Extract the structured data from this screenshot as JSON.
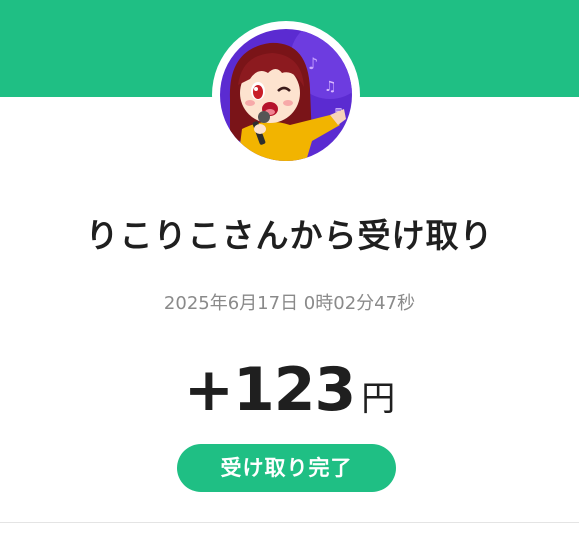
{
  "header": {
    "band_color": "#1fbf84"
  },
  "avatar": {
    "icon": "user-avatar-anime-singer"
  },
  "transaction": {
    "title": "りこりこさんから受け取り",
    "timestamp": "2025年6月17日 0時02分47秒",
    "amount": "+123",
    "currency": "円",
    "status": "受け取り完了",
    "status_color": "#1fbf84"
  }
}
